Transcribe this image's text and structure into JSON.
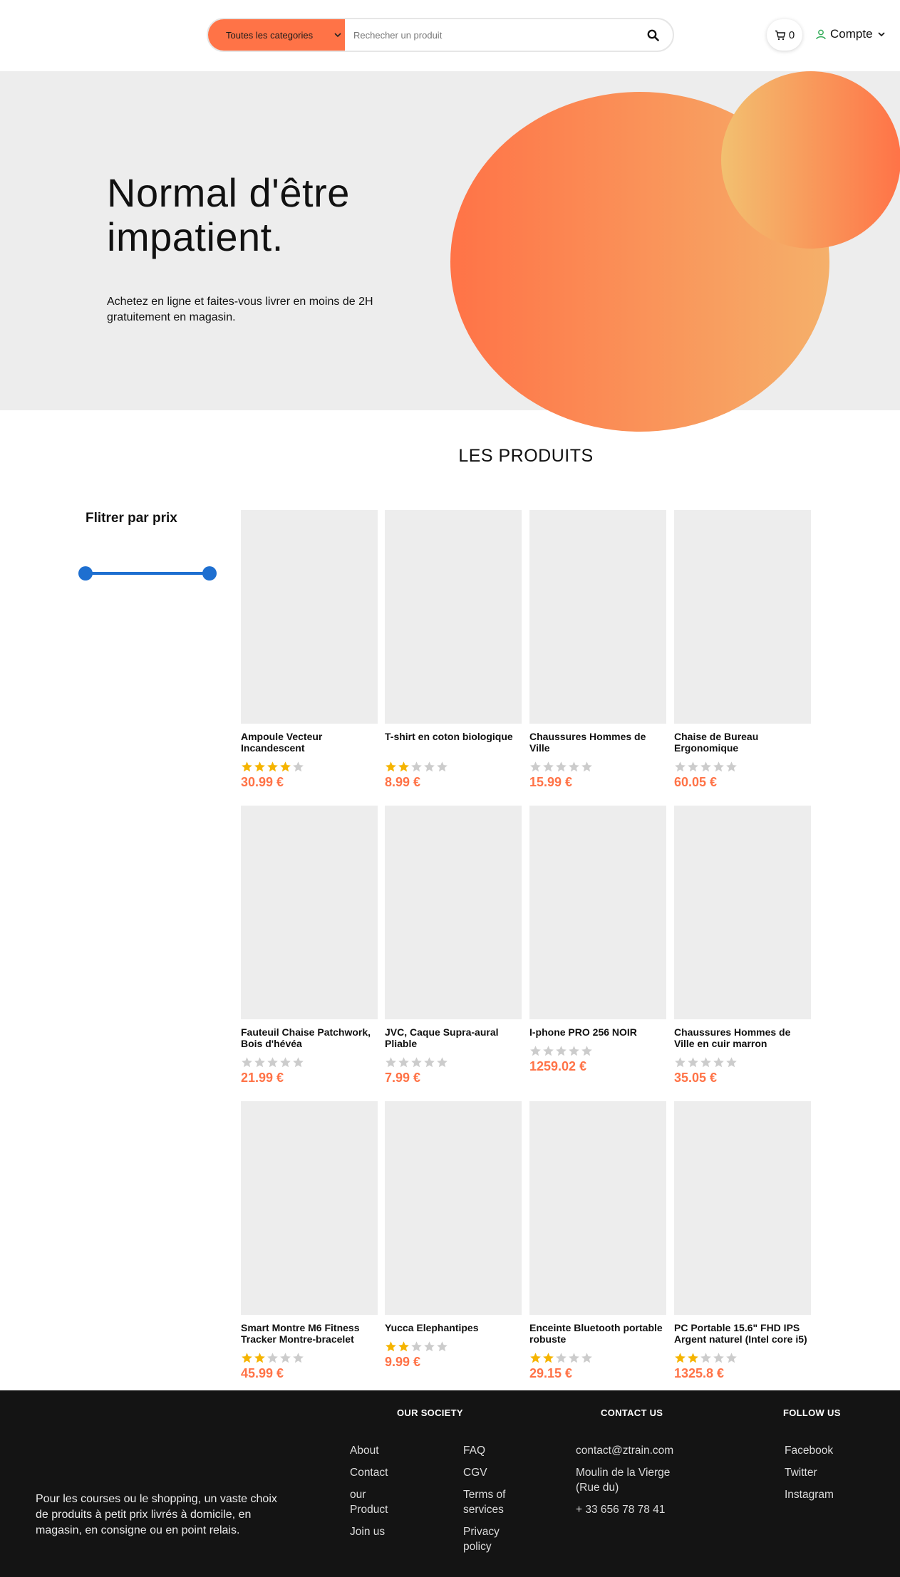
{
  "header": {
    "category_label": "Toutes les categories",
    "search_placeholder": "Rechecher un produit",
    "cart_count": "0",
    "account_label": "Compte"
  },
  "hero": {
    "title_line1": "Normal d'être",
    "title_line2": "impatient.",
    "subtitle": "Achetez en ligne et faites-vous livrer en moins de 2H gratuitement en magasin."
  },
  "products_section": {
    "title": "LES PRODUITS",
    "filter_title": "Flitrer par prix",
    "price_slider": {
      "min_position": 0,
      "max_position": 1
    }
  },
  "products": [
    {
      "name": "Ampoule Vecteur Incandescent",
      "rating": 4,
      "price": "30.99 €"
    },
    {
      "name": "T-shirt en coton biologique",
      "rating": 2,
      "price": "8.99 €"
    },
    {
      "name": "Chaussures Hommes de Ville",
      "rating": 0,
      "price": "15.99 €"
    },
    {
      "name": "Chaise de Bureau Ergonomique",
      "rating": 0,
      "price": "60.05 €"
    },
    {
      "name": "Fauteuil Chaise Patchwork, Bois d'hévéa",
      "rating": 0,
      "price": "21.99 €"
    },
    {
      "name": "JVC, Caque Supra-aural Pliable",
      "rating": 0,
      "price": "7.99 €"
    },
    {
      "name": "I-phone PRO 256 NOIR",
      "rating": 0,
      "price": "1259.02 €"
    },
    {
      "name": "Chaussures Hommes de Ville en cuir marron",
      "rating": 0,
      "price": "35.05 €"
    },
    {
      "name": "Smart Montre M6 Fitness Tracker Montre-bracelet",
      "rating": 2,
      "price": "45.99 €"
    },
    {
      "name": "Yucca Elephantipes",
      "rating": 2,
      "price": "9.99 €"
    },
    {
      "name": "Enceinte Bluetooth portable robuste",
      "rating": 2,
      "price": "29.15 €"
    },
    {
      "name": "PC Portable 15.6\" FHD IPS Argent naturel (Intel core i5)",
      "rating": 2,
      "price": "1325.8 €"
    }
  ],
  "colors": {
    "accent": "#ff7347",
    "star_filled": "#f5b400",
    "star_empty": "#cccccc",
    "slider": "#1e6fd0",
    "footer_bg": "#141414"
  },
  "footer": {
    "about": "Pour les courses ou le shopping, un vaste choix de produits à petit prix livrés à domicile, en magasin, en consigne ou en point relais.",
    "society_title": "OUR SOCIETY",
    "society_links_col1": [
      "About",
      "Contact",
      "our Product",
      "Join us"
    ],
    "society_links_col2": [
      "FAQ",
      "CGV",
      "Terms of services",
      "Privacy policy"
    ],
    "contact_title": "CONTACT US",
    "contact_lines": [
      "contact@ztrain.com",
      "Moulin de la Vierge (Rue du)",
      "+ 33 656 78 78 41"
    ],
    "follow_title": "FOLLOW US",
    "follow_links": [
      "Facebook",
      "Twitter",
      "Instagram"
    ]
  }
}
